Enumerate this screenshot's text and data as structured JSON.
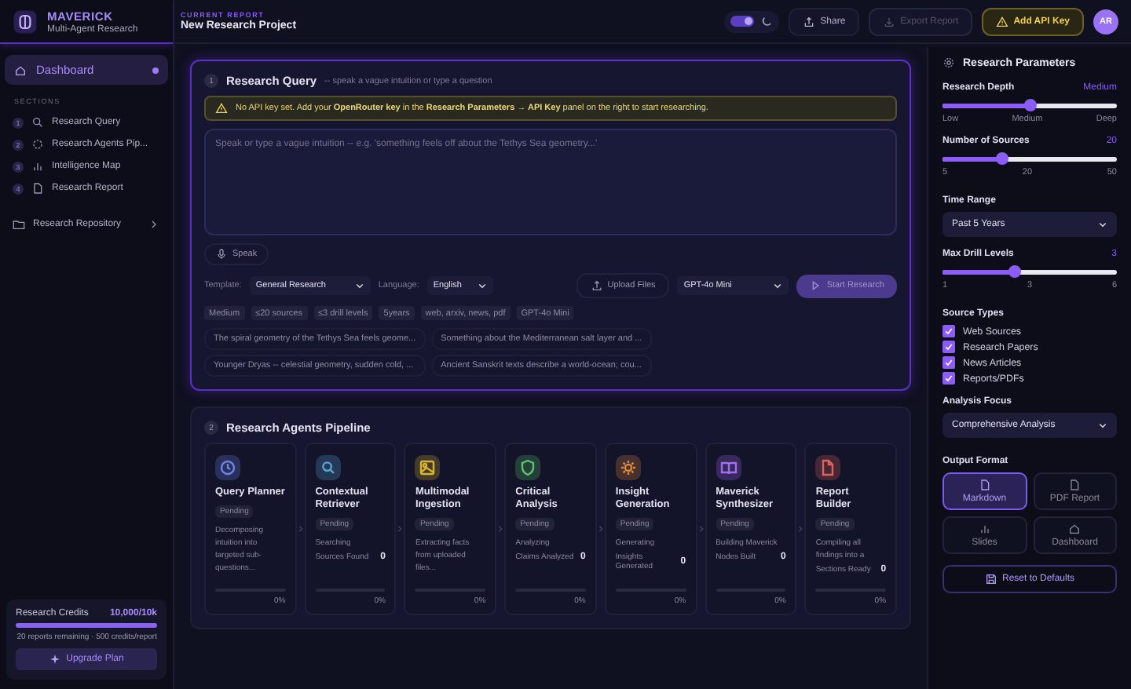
{
  "sidebar": {
    "brand": {
      "name": "MAVERICK",
      "subtitle": "Multi-Agent Research"
    },
    "dashboard": {
      "label": "Dashboard",
      "selected": true
    },
    "sections_heading": "SECTIONS",
    "sections": [
      {
        "number": "1",
        "label": "Research Query",
        "kind": "search"
      },
      {
        "number": "2",
        "label": "Research Agents Pip...",
        "kind": "pipeline"
      },
      {
        "number": "3",
        "label": "Intelligence Map",
        "kind": "chart"
      },
      {
        "number": "4",
        "label": "Research Report",
        "kind": "doc"
      }
    ],
    "repository": {
      "label": "Research Repository",
      "expanded": false
    },
    "credits": {
      "label": "Research Credits",
      "value": "10,000/10k",
      "level": 1,
      "note": "20 reports remaining · 500 credits/report",
      "upgrade_button": "Upgrade Plan"
    }
  },
  "topbar": {
    "eyebrow": "CURRENT REPORT",
    "title": "New Research Project",
    "dark_mode": true,
    "share_button": "Share",
    "export_button": {
      "label": "Export Report",
      "disabled": true
    },
    "api_key_button": "Add API Key",
    "avatar": "AR"
  },
  "query": {
    "number": "1",
    "title": "Research Query",
    "hint": "-- speak a vague intuition or type a question",
    "warning": "No API key set. Add your **OpenRouter key** in the **Research Parameters → API Key** panel on the right to start researching.",
    "placeholder": "Speak or type a vague intuition -- e.g. 'something feels off about the Tethys Sea geometry...'",
    "speak_button": "Speak",
    "template": {
      "label": "Template:",
      "value": "General Research"
    },
    "language": {
      "label": "Language:",
      "value": "English"
    },
    "upload_button": "Upload Files",
    "model": "GPT-4o Mini",
    "start_button": {
      "label": "Start Research",
      "disabled": true
    },
    "chips": [
      "Medium",
      "≤20 sources",
      "≤3 drill levels",
      "5years",
      "web, arxiv, news, pdf",
      "GPT-4o Mini"
    ],
    "suggestions": [
      "The spiral geometry of the Tethys Sea feels geome...",
      "Something about the Mediterranean salt layer and ...",
      "Younger Dryas -- celestial geometry, sudden cold, ...",
      "Ancient Sanskrit texts describe a world-ocean; cou..."
    ]
  },
  "pipeline": {
    "number": "2",
    "title": "Research Agents Pipeline",
    "agents": [
      {
        "name": "Query Planner",
        "kind": "clock",
        "color": "#6b86e8",
        "status": "Pending",
        "description": "Decomposing intuition into targeted sub-questions...",
        "level": 0,
        "progress": "0%"
      },
      {
        "name": "Contextual Retriever",
        "kind": "search",
        "color": "#5aa6d6",
        "status": "Pending",
        "description": "Searching",
        "stat_label": "Sources Found",
        "stat_value": "0",
        "level": 0,
        "progress": "0%"
      },
      {
        "name": "Multimodal Ingestion",
        "kind": "image",
        "color": "#d9b52a",
        "status": "Pending",
        "description": "Extracting facts from uploaded files...",
        "level": 0,
        "progress": "0%"
      },
      {
        "name": "Critical Analysis",
        "kind": "shield",
        "color": "#5cc46a",
        "status": "Pending",
        "description": "Analyzing",
        "stat_label": "Claims Analyzed",
        "stat_value": "0",
        "level": 0,
        "progress": "0%"
      },
      {
        "name": "Insight Generation",
        "kind": "sun",
        "color": "#e08a3c",
        "status": "Pending",
        "description": "Generating",
        "stat_label": "Insights Generated",
        "stat_value": "0",
        "level": 0,
        "progress": "0%"
      },
      {
        "name": "Maverick Synthesizer",
        "kind": "book",
        "color": "#a46cf0",
        "status": "Pending",
        "description": "Building Maverick",
        "stat_label": "Nodes Built",
        "stat_value": "0",
        "level": 0,
        "progress": "0%"
      },
      {
        "name": "Report Builder",
        "kind": "doc",
        "color": "#e0645a",
        "status": "Pending",
        "description": "Compiling all findings into a",
        "stat_label": "Sections Ready",
        "stat_value": "0",
        "level": 0,
        "progress": "0%"
      }
    ]
  },
  "params": {
    "title": "Research Parameters",
    "depth": {
      "label": "Research Depth",
      "value": "Medium",
      "level": 0.5,
      "ticks": [
        "Low",
        "Medium",
        "Deep"
      ]
    },
    "sources": {
      "label": "Number of Sources",
      "value": "20",
      "level": 0.34,
      "ticks": [
        "5",
        "20",
        "50"
      ]
    },
    "time_range": {
      "label": "Time Range",
      "value": "Past 5 Years"
    },
    "drill": {
      "label": "Max Drill Levels",
      "value": "3",
      "level": 0.41,
      "ticks": [
        "1",
        "3",
        "6"
      ]
    },
    "source_types": {
      "label": "Source Types",
      "items": [
        {
          "label": "Web Sources",
          "checked": true
        },
        {
          "label": "Research Papers",
          "checked": true
        },
        {
          "label": "News Articles",
          "checked": true
        },
        {
          "label": "Reports/PDFs",
          "checked": true
        }
      ]
    },
    "analysis_focus": {
      "label": "Analysis Focus",
      "value": "Comprehensive Analysis"
    },
    "output_format": {
      "label": "Output Format",
      "options": [
        {
          "label": "Markdown",
          "kind": "doc",
          "selected": true
        },
        {
          "label": "PDF Report",
          "kind": "doc",
          "selected": false
        },
        {
          "label": "Slides",
          "kind": "chart",
          "selected": false
        },
        {
          "label": "Dashboard",
          "kind": "home",
          "selected": false
        }
      ]
    },
    "reset_button": "Reset to Defaults"
  }
}
